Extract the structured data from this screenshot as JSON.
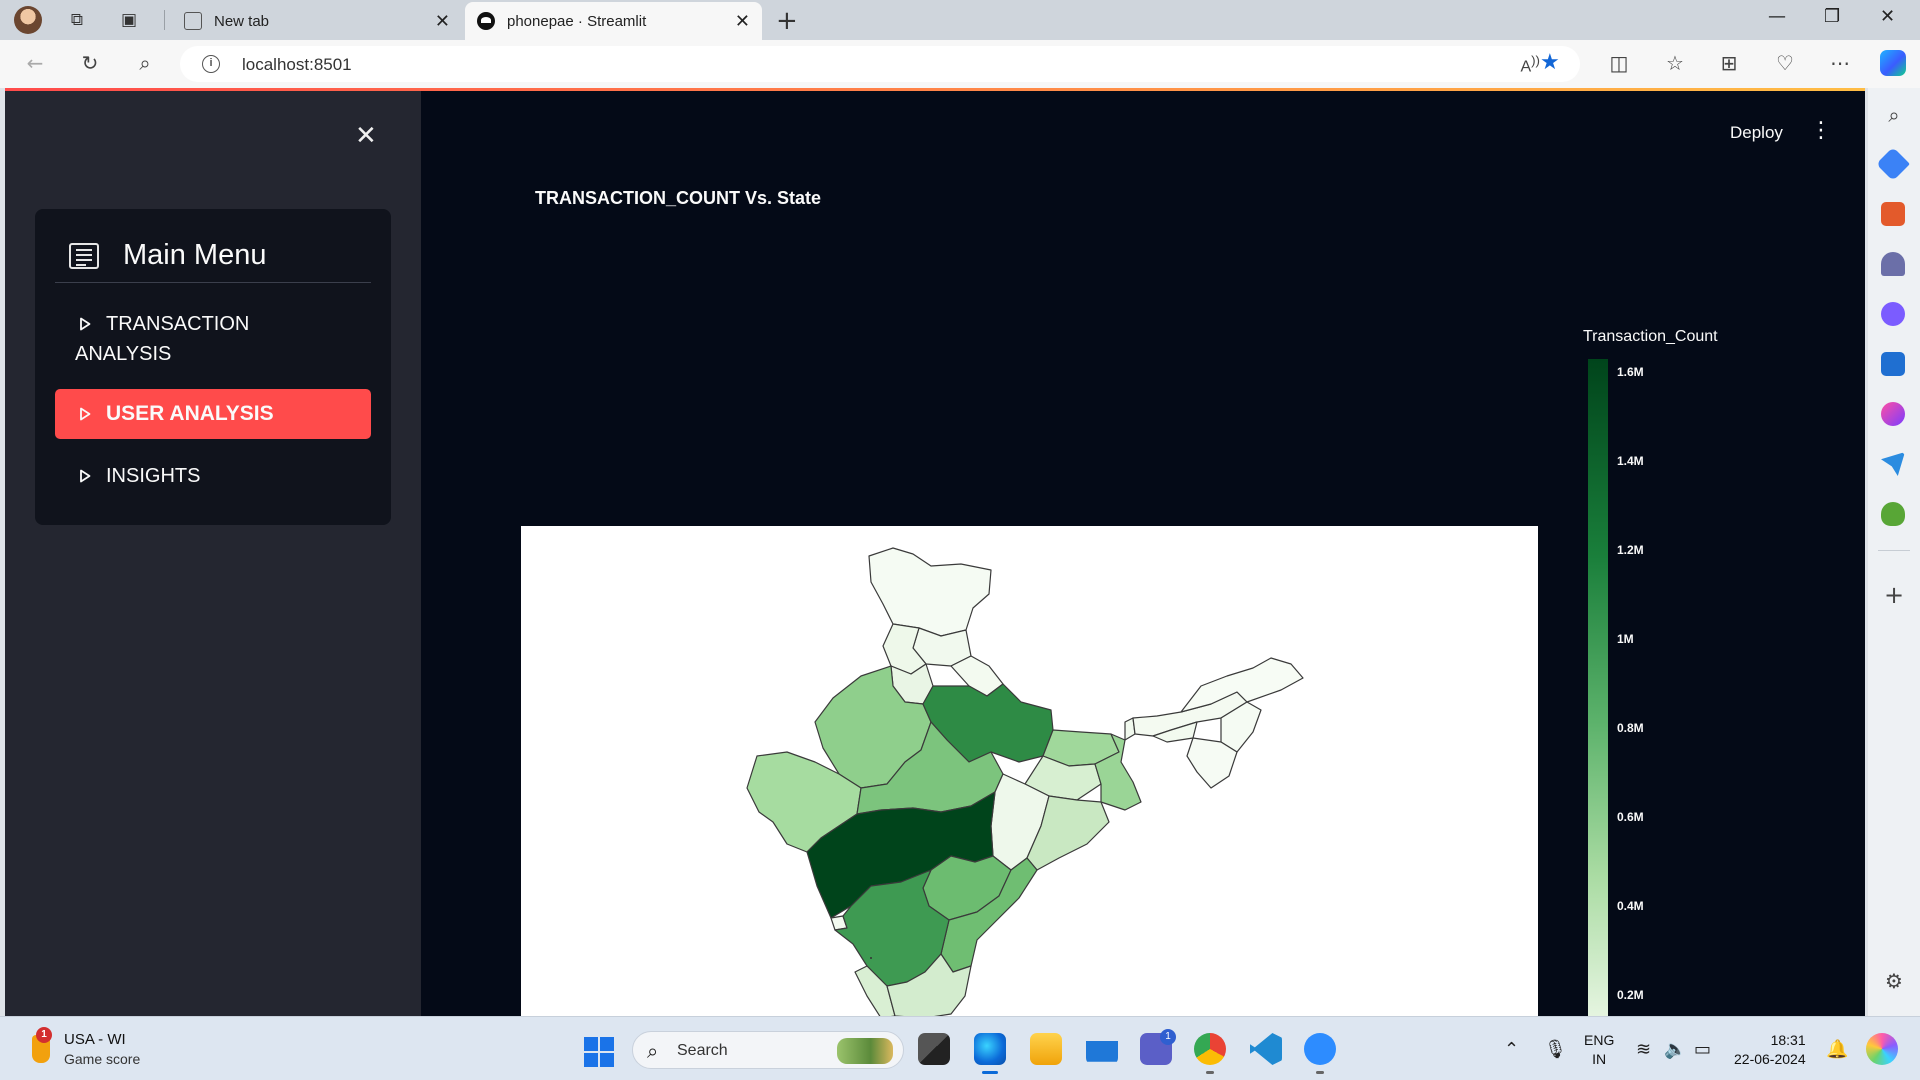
{
  "browser": {
    "tabs": [
      {
        "title": "New tab",
        "active": false
      },
      {
        "title": "phonepae · Streamlit",
        "active": true
      }
    ],
    "url": "localhost:8501"
  },
  "app": {
    "deploy_label": "Deploy",
    "sidebar": {
      "menu_title": "Main Menu",
      "items": [
        {
          "label_line1": "TRANSACTION",
          "label_line2": "ANALYSIS",
          "selected": false
        },
        {
          "label": "USER ANALYSIS",
          "selected": true
        },
        {
          "label": "INSIGHTS",
          "selected": false
        }
      ]
    },
    "chart": {
      "title": "TRANSACTION_COUNT Vs. State",
      "colorbar_title": "Transaction_Count",
      "colorbar_ticks": [
        "1.6M",
        "1.4M",
        "1.2M",
        "1M",
        "0.8M",
        "0.6M",
        "0.4M",
        "0.2M"
      ],
      "colorscale": [
        "#00441b",
        "#1a7f3b",
        "#5cb26b",
        "#a9dba2",
        "#e6f5e1"
      ]
    }
  },
  "chart_data": {
    "type": "heatmap",
    "title": "TRANSACTION_COUNT Vs. State",
    "colorbar_title": "Transaction_Count",
    "colorbar_ticks": [
      "1.6M",
      "1.4M",
      "1.2M",
      "1M",
      "0.8M",
      "0.6M",
      "0.4M",
      "0.2M"
    ],
    "legend_position": "right"
  },
  "taskbar": {
    "weather_line1": "USA - WI",
    "weather_line2": "Game score",
    "weather_badge": "1",
    "search_label": "Search",
    "lang_line1": "ENG",
    "lang_line2": "IN",
    "time": "18:31",
    "date": "22-06-2024",
    "teams_badge": "1"
  }
}
